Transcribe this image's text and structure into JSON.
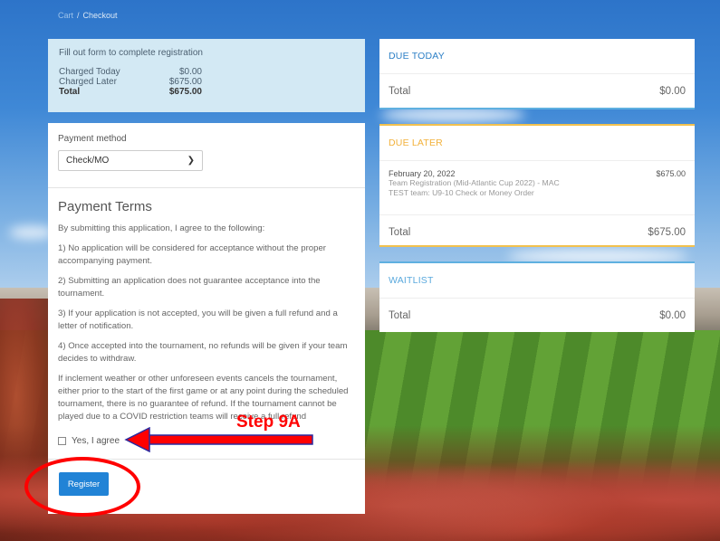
{
  "breadcrumb": {
    "items": [
      "Cart",
      "Checkout"
    ]
  },
  "summary": {
    "intro": "Fill out form to complete registration",
    "rows": [
      {
        "label": "Charged Today",
        "value": "$0.00"
      },
      {
        "label": "Charged Later",
        "value": "$675.00"
      },
      {
        "label": "Total",
        "value": "$675.00"
      }
    ]
  },
  "payment": {
    "label": "Payment method",
    "selected": "Check/MO"
  },
  "terms": {
    "title": "Payment Terms",
    "paragraphs": [
      "By submitting this application, I agree to the following:",
      "1) No application will be considered for acceptance without the proper accompanying payment.",
      "2) Submitting an application does not guarantee acceptance into the tournament.",
      "3) If your application is not accepted, you will be given a full refund and a letter of notification.",
      "4) Once accepted into the tournament, no refunds will be given if your team decides to withdraw.",
      "If inclement weather or other unforeseen events cancels the tournament, either prior to the start of the first game or at any point during the scheduled tournament, there is no guarantee of refund. If the tournament cannot be played due to a COVID restriction teams will receive a full refund"
    ],
    "agree_label": "Yes, I agree",
    "agree_checked": false
  },
  "register_label": "Register",
  "due_today": {
    "title": "DUE TODAY",
    "total_label": "Total",
    "total_value": "$0.00"
  },
  "due_later": {
    "title": "DUE LATER",
    "item": {
      "date": "February 20, 2022",
      "amount": "$675.00",
      "line1": "Team Registration (Mid-Atlantic Cup 2022) - MAC",
      "line2": "TEST team: U9-10 Check or Money Order"
    },
    "total_label": "Total",
    "total_value": "$675.00"
  },
  "waitlist": {
    "title": "WAITLIST",
    "total_label": "Total",
    "total_value": "$0.00"
  },
  "annotation": {
    "step_label": "Step 9A"
  },
  "colors": {
    "accent_blue": "#2183d6",
    "due_later_yellow": "#f2c14e",
    "annotation_red": "#ff0000"
  }
}
